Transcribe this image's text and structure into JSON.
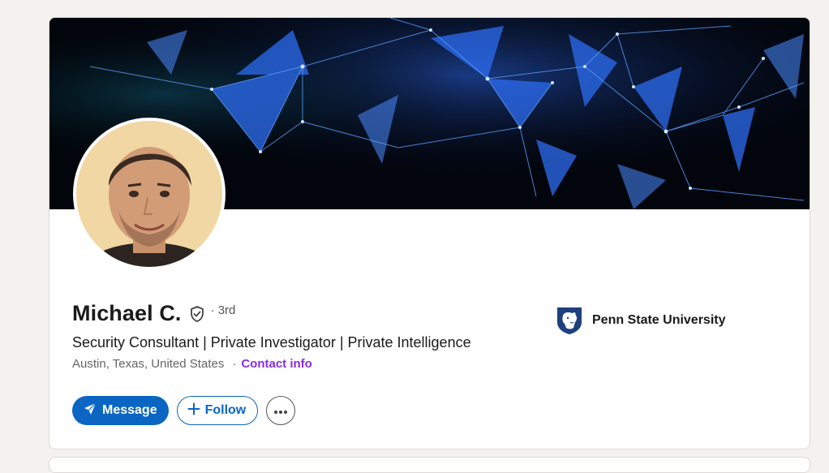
{
  "profile": {
    "name": "Michael C.",
    "degree": "· 3rd",
    "headline": "Security Consultant | Private Investigator | Private Intelligence",
    "location": "Austin, Texas, United States",
    "separator": "·",
    "contact_label": "Contact info"
  },
  "education": {
    "school": "Penn State University"
  },
  "actions": {
    "message_label": "Message",
    "follow_label": "Follow"
  },
  "icons": {
    "verify": "shield-check-icon",
    "message": "paper-plane-icon",
    "follow": "plus-icon",
    "more": "ellipsis-icon"
  },
  "colors": {
    "accent": "#0a66c2",
    "contact": "#8a2be2",
    "background": "#f4f2ee"
  }
}
